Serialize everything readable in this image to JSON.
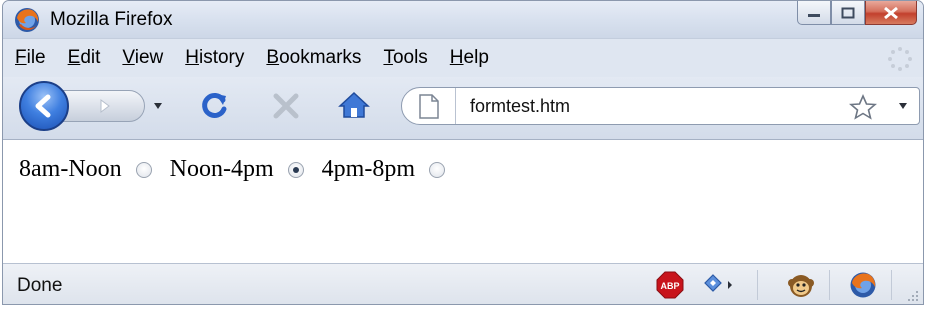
{
  "window": {
    "title": "Mozilla Firefox"
  },
  "menu": [
    "File",
    "Edit",
    "View",
    "History",
    "Bookmarks",
    "Tools",
    "Help"
  ],
  "address_bar": {
    "url": "formtest.htm"
  },
  "content": {
    "radios": [
      {
        "label": "8am-Noon",
        "checked": false
      },
      {
        "label": "Noon-4pm",
        "checked": true
      },
      {
        "label": "4pm-8pm",
        "checked": false
      }
    ]
  },
  "status": {
    "text": "Done"
  },
  "icons": {
    "app": "firefox-logo-icon",
    "back": "back-arrow-icon",
    "forward": "forward-arrow-icon",
    "reload": "reload-icon",
    "stop": "stop-icon",
    "home": "home-icon",
    "page": "page-icon",
    "bookmark": "star-icon",
    "adblock": "adblock-plus-icon"
  },
  "colors": {
    "accent": "#2f6fd6",
    "reload": "#2b62c9",
    "adblock": "#c8141c"
  }
}
